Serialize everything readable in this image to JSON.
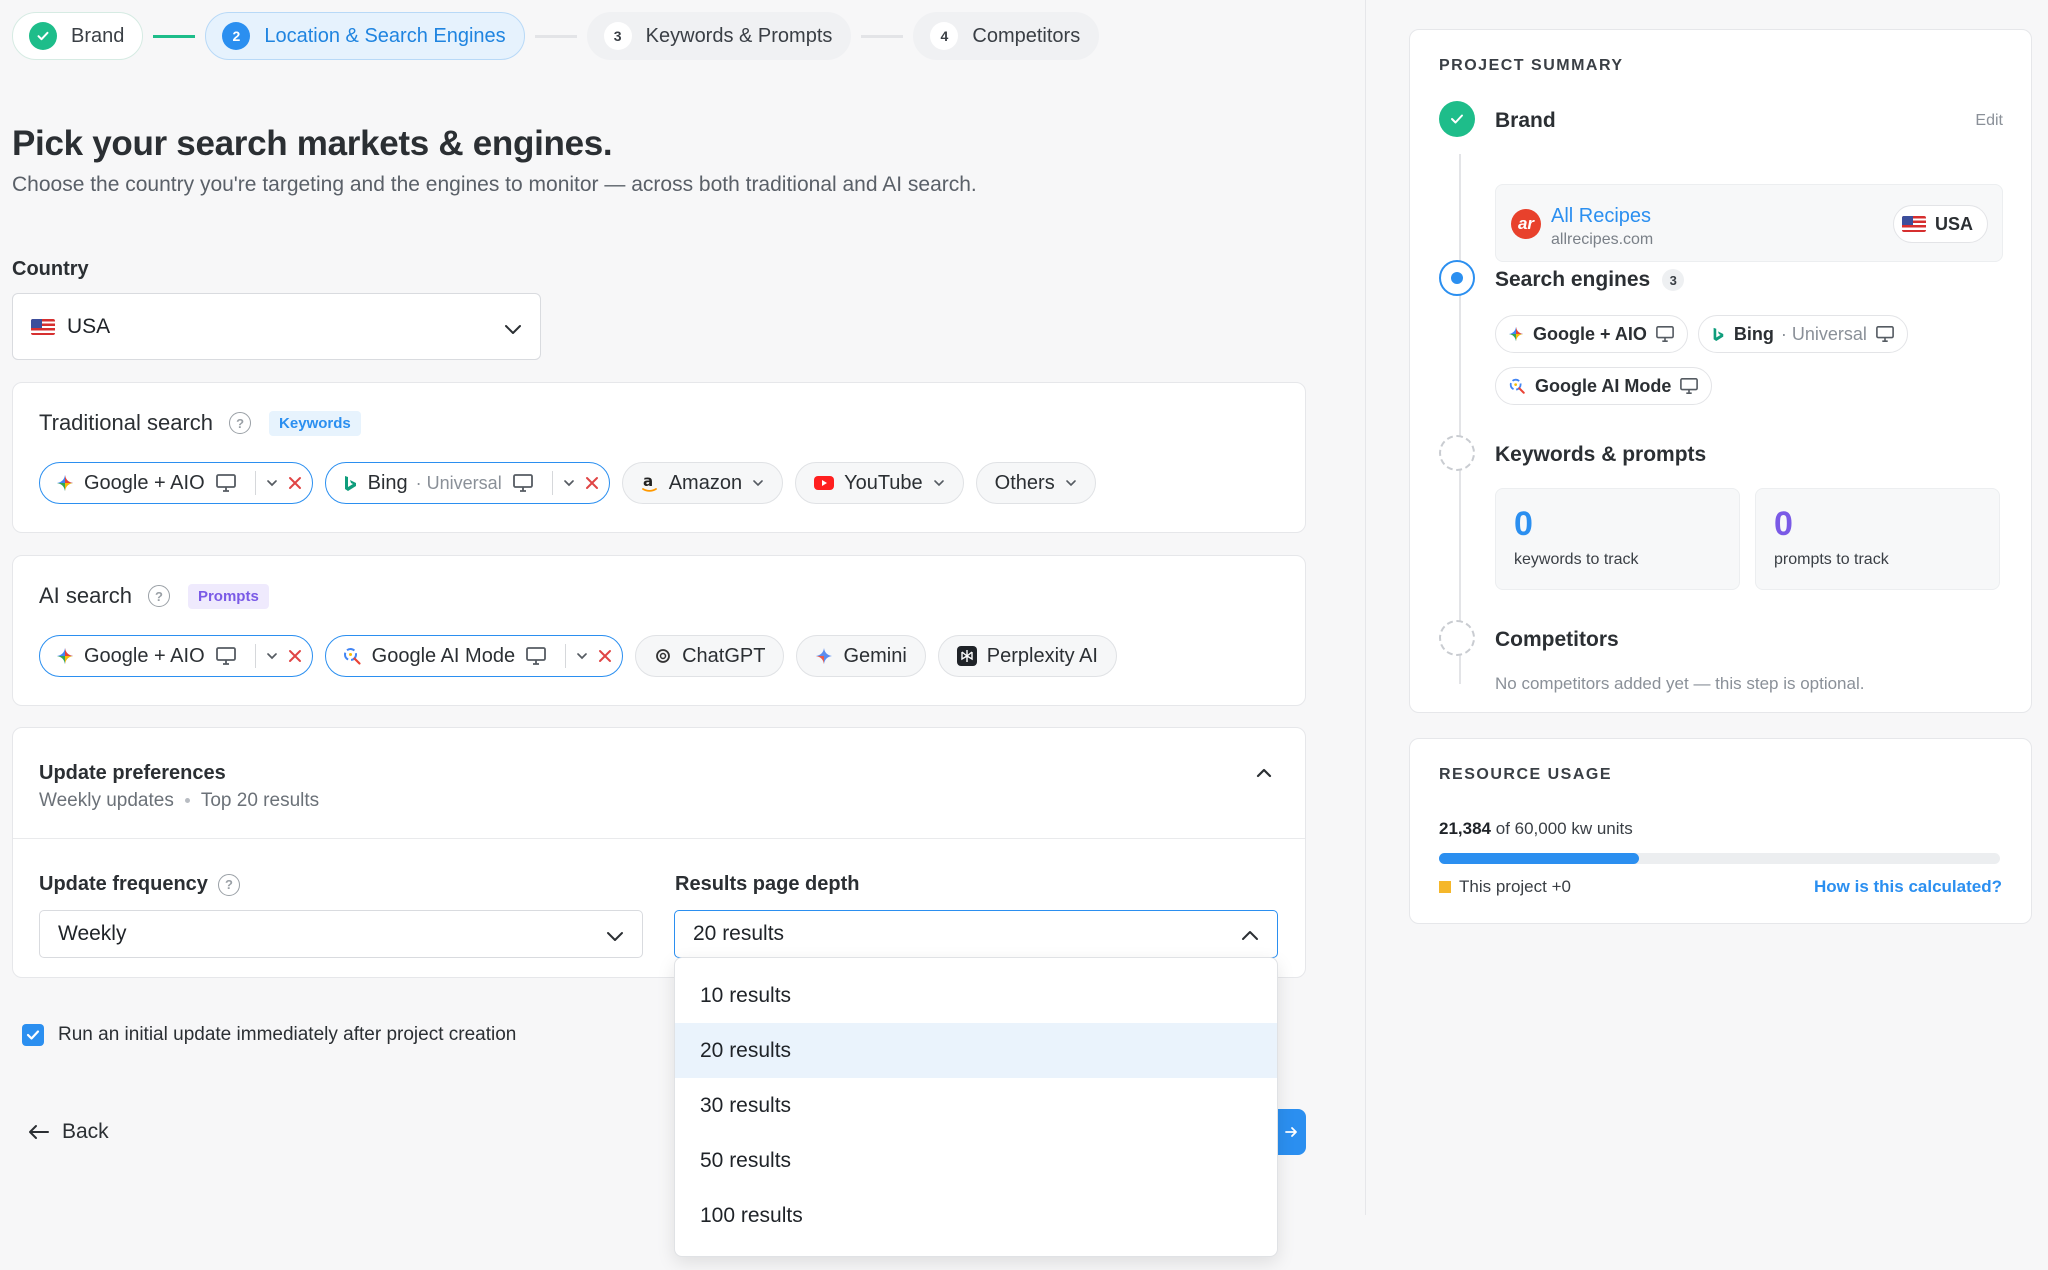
{
  "stepper": {
    "steps": [
      {
        "num": "✓",
        "label": "Brand"
      },
      {
        "num": "2",
        "label": "Location & Search Engines"
      },
      {
        "num": "3",
        "label": "Keywords & Prompts"
      },
      {
        "num": "4",
        "label": "Competitors"
      }
    ]
  },
  "header": {
    "title": "Pick your search markets & engines.",
    "subtitle": "Choose the country you're targeting and the engines to monitor — across both traditional and AI search."
  },
  "country": {
    "label": "Country",
    "value": "USA"
  },
  "traditional": {
    "title": "Traditional search",
    "tag": "Keywords",
    "engines": [
      {
        "name": "Google + AIO"
      },
      {
        "name": "Bing",
        "sub": "· Universal"
      },
      {
        "name": "Amazon"
      },
      {
        "name": "YouTube"
      },
      {
        "name": "Others"
      }
    ]
  },
  "ai": {
    "title": "AI search",
    "tag": "Prompts",
    "engines": [
      {
        "name": "Google + AIO"
      },
      {
        "name": "Google AI Mode"
      },
      {
        "name": "ChatGPT"
      },
      {
        "name": "Gemini"
      },
      {
        "name": "Perplexity AI"
      }
    ]
  },
  "preferences": {
    "title": "Update preferences",
    "summary_freq": "Weekly updates",
    "summary_depth": "Top 20 results",
    "frequency_label": "Update frequency",
    "frequency_value": "Weekly",
    "depth_label": "Results page depth",
    "depth_value": "20 results",
    "depth_options": [
      "10 results",
      "20 results",
      "30 results",
      "50 results",
      "100 results"
    ],
    "depth_selected_index": 1
  },
  "initial_update": {
    "label": "Run an initial update immediately after project creation",
    "checked": true
  },
  "nav": {
    "back": "Back"
  },
  "summary": {
    "heading": "PROJECT SUMMARY",
    "brand": {
      "title": "Brand",
      "edit": "Edit",
      "name": "All Recipes",
      "url": "allrecipes.com",
      "logo": "ar",
      "country": "USA"
    },
    "engines": {
      "title": "Search engines",
      "count": "3",
      "chips": [
        {
          "name": "Google + AIO"
        },
        {
          "name": "Bing",
          "sub": "· Universal"
        },
        {
          "name": "Google AI Mode"
        }
      ]
    },
    "keywords": {
      "title": "Keywords & prompts",
      "keywords_count": "0",
      "keywords_label": "keywords to track",
      "prompts_count": "0",
      "prompts_label": "prompts to track"
    },
    "competitors": {
      "title": "Competitors",
      "note": "No competitors added yet — this step is optional."
    }
  },
  "usage": {
    "heading": "RESOURCE USAGE",
    "used": "21,384",
    "total_text": "of 60,000 kw units",
    "fraction": 0.356,
    "legend": "This project +0",
    "link": "How is this calculated?"
  },
  "colors": {
    "accent": "#2b8ff0",
    "success": "#1ebd8a",
    "prompt": "#7a5ae6",
    "legend_this_project": "#f5b72a"
  }
}
